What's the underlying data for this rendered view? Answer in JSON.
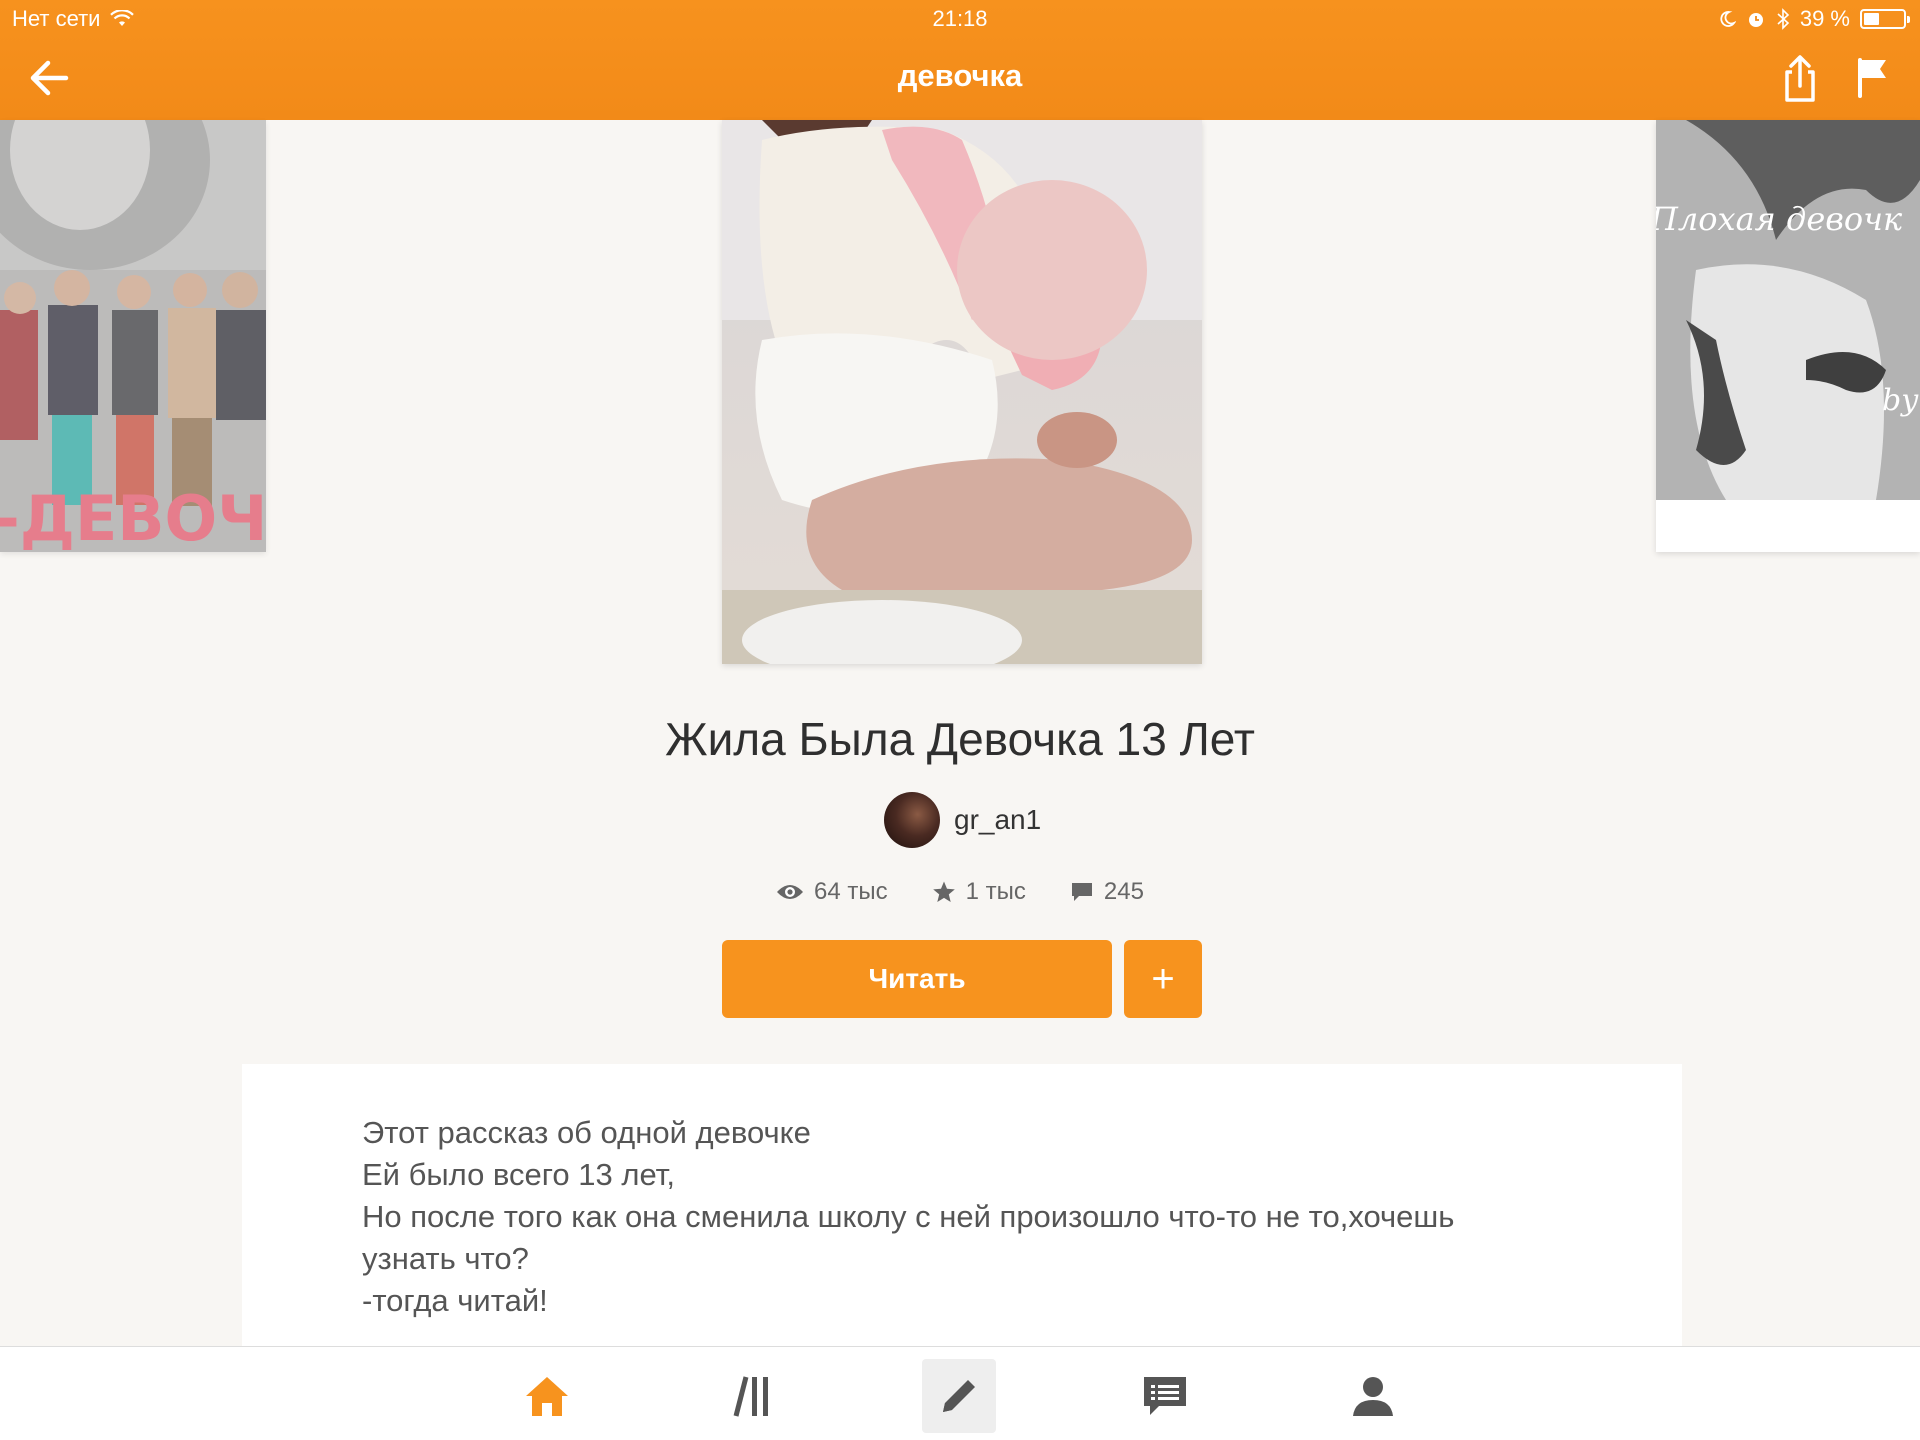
{
  "status_bar": {
    "network": "Нет сети",
    "time": "21:18",
    "battery": "39 %",
    "battery_level": 0.39
  },
  "header": {
    "title": "девочка"
  },
  "carousel": {
    "left_cover_text": "-ДЕВОЧК",
    "right_cover_text": "Плохая девочк",
    "right_cover_sub": "by"
  },
  "story": {
    "title": "Жила Была Девочка 13 Лет",
    "author": "gr_an1",
    "views": "64 тыс",
    "votes": "1 тыс",
    "comments": "245",
    "read_label": "Читать",
    "add_label": "+"
  },
  "description": {
    "lines": [
      "Этот рассказ об одной девочке",
      "Ей было всего 13 лет,",
      "Но после того как она сменила школу с ней произошло что-то не то,хочешь",
      "узнать что?",
      "-тогда читай!"
    ]
  },
  "colors": {
    "accent": "#f7931e",
    "background": "#f8f6f3"
  },
  "tabbar": {
    "items": [
      "home-icon",
      "library-icon",
      "write-icon",
      "messages-icon",
      "profile-icon"
    ],
    "active": "home-icon"
  }
}
